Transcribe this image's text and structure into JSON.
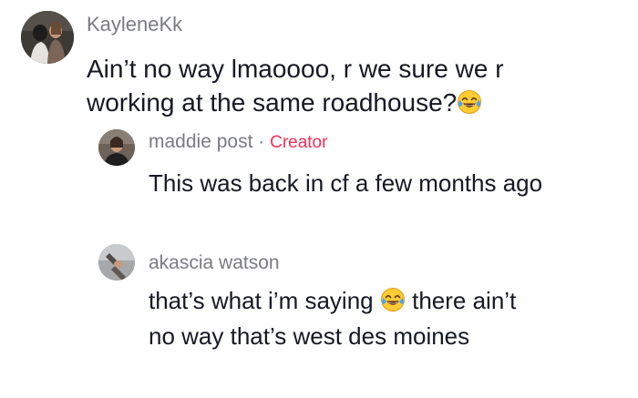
{
  "comments": [
    {
      "username": "KayleneKk",
      "text_before": "Ain’t no way lmaoooo, r we sure we r working at the same roadhouse?",
      "emoji": "tears-of-joy-emoji",
      "text_after": ""
    },
    {
      "username": "maddie post",
      "separator": "·",
      "badge": "Creator",
      "text_before": "This was back in cf a few months ago",
      "text_after": ""
    },
    {
      "username": "akascia watson",
      "text_before": "that’s what i’m saying",
      "emoji": "tears-of-joy-emoji",
      "text_after": "there ain’t no way that’s west des moines"
    }
  ],
  "colors": {
    "username": "#7a7b80",
    "text": "#161823",
    "creator_badge": "#fe2c55",
    "emoji_face": "#ffcc33",
    "emoji_tears": "#4aa3f0"
  }
}
